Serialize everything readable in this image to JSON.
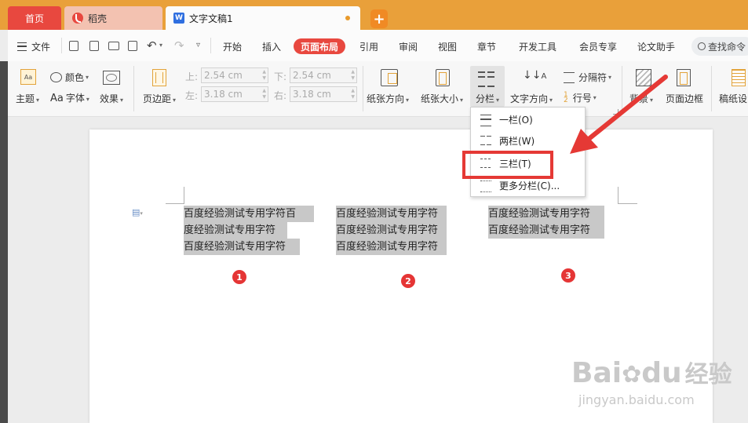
{
  "tabs": {
    "home": "首页",
    "daoke": "稻壳",
    "doc": "文字文稿1",
    "add": "+"
  },
  "menu": {
    "file": "文件",
    "items": [
      "开始",
      "插入",
      "页面布局",
      "引用",
      "审阅",
      "视图",
      "章节",
      "开发工具",
      "会员专享",
      "论文助手"
    ],
    "search": "查找命令"
  },
  "ribbon": {
    "theme": "主题",
    "color": "颜色",
    "font": "字体",
    "font_prefix": "Aa",
    "effect": "效果",
    "margin": "页边距",
    "top_label": "上:",
    "top_value": "2.54 cm",
    "bottom_label": "下:",
    "bottom_value": "2.54 cm",
    "left_label": "左:",
    "left_value": "3.18 cm",
    "right_label": "右:",
    "right_value": "3.18 cm",
    "orientation": "纸张方向",
    "size": "纸张大小",
    "columns": "分栏",
    "text_direction": "文字方向",
    "separator": "分隔符",
    "line_number": "行号",
    "background": "背景",
    "page_border": "页面边框",
    "manuscript": "稿纸设"
  },
  "columns_menu": {
    "one": "一栏(O)",
    "two": "两栏(W)",
    "three": "三栏(T)",
    "more": "更多分栏(C)..."
  },
  "document": {
    "col1": [
      "百度经验测试专用字符百",
      "度经验测试专用字符",
      "百度经验测试专用字符"
    ],
    "col2": [
      "百度经验测试专用字符",
      "百度经验测试专用字符",
      "百度经验测试专用字符"
    ],
    "col3": [
      "百度经验测试专用字符",
      "百度经验测试专用字符"
    ],
    "badges": [
      "1",
      "2",
      "3"
    ]
  },
  "watermark": {
    "brand": "Bai",
    "brand2": "du",
    "cn": "经验",
    "url": "jingyan.baidu.com"
  },
  "colors": {
    "accent": "#e8483f",
    "tabbar": "#e9a03a",
    "annotation": "#e53935"
  }
}
